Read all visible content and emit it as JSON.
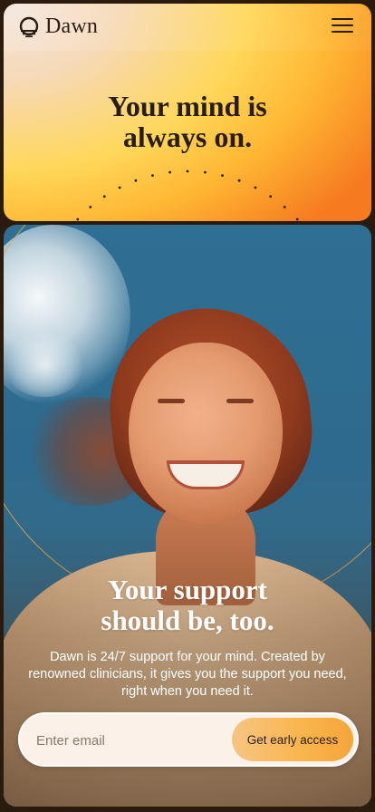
{
  "brand": {
    "name": "Dawn",
    "logo_icon": "dawn-sun-icon",
    "accent": "#F7A83A",
    "ink": "#2A1D14"
  },
  "nav": {
    "menu_icon": "hamburger-menu-icon"
  },
  "hero": {
    "line1": "Your mind is",
    "line2": "always on."
  },
  "support": {
    "line1": "Your support",
    "line2": "should be, too.",
    "description": "Dawn is 24/7 support for your mind. Created by renowned clinicians, it gives you the support you need, right when you need it."
  },
  "signup": {
    "email_placeholder": "Enter email",
    "email_value": "",
    "cta_label": "Get early access"
  }
}
